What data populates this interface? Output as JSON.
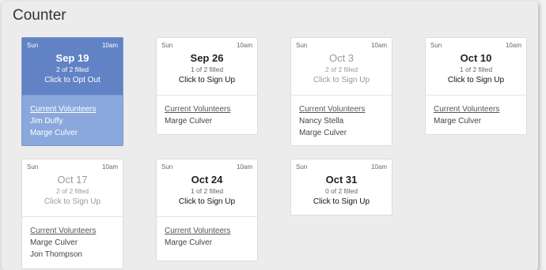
{
  "page": {
    "title": "Counter"
  },
  "cards": [
    {
      "day": "Sun",
      "time": "10am",
      "date": "Sep 19",
      "filled": "2 of 2 filled",
      "action": "Click to Opt Out",
      "volunteers_heading": "Current Volunteers",
      "volunteers": [
        "Jim Duffy",
        "Marge Culver"
      ]
    },
    {
      "day": "Sun",
      "time": "10am",
      "date": "Sep 26",
      "filled": "1 of 2 filled",
      "action": "Click to Sign Up",
      "volunteers_heading": "Current Volunteers",
      "volunteers": [
        "Marge Culver"
      ]
    },
    {
      "day": "Sun",
      "time": "10am",
      "date": "Oct 3",
      "filled": "2 of 2 filled",
      "action": "Click to Sign Up",
      "volunteers_heading": "Current Volunteers",
      "volunteers": [
        "Nancy Stella",
        "Marge Culver"
      ]
    },
    {
      "day": "Sun",
      "time": "10am",
      "date": "Oct 10",
      "filled": "1 of 2 filled",
      "action": "Click to Sign Up",
      "volunteers_heading": "Current Volunteers",
      "volunteers": [
        "Marge Culver"
      ]
    },
    {
      "day": "Sun",
      "time": "10am",
      "date": "Oct 17",
      "filled": "2 of 2 filled",
      "action": "Click to Sign Up",
      "volunteers_heading": "Current Volunteers",
      "volunteers": [
        "Marge Culver",
        "Jon Thompson"
      ]
    },
    {
      "day": "Sun",
      "time": "10am",
      "date": "Oct 24",
      "filled": "1 of 2 filled",
      "action": "Click to Sign Up",
      "volunteers_heading": "Current Volunteers",
      "volunteers": [
        "Marge Culver"
      ]
    },
    {
      "day": "Sun",
      "time": "10am",
      "date": "Oct 31",
      "filled": "0 of 2 filled",
      "action": "Click to Sign Up",
      "volunteers_heading": "",
      "volunteers": []
    }
  ],
  "colors": {
    "selected_top": "#6182c4",
    "selected_body": "#8aa8dc",
    "panel": "#ececec"
  }
}
